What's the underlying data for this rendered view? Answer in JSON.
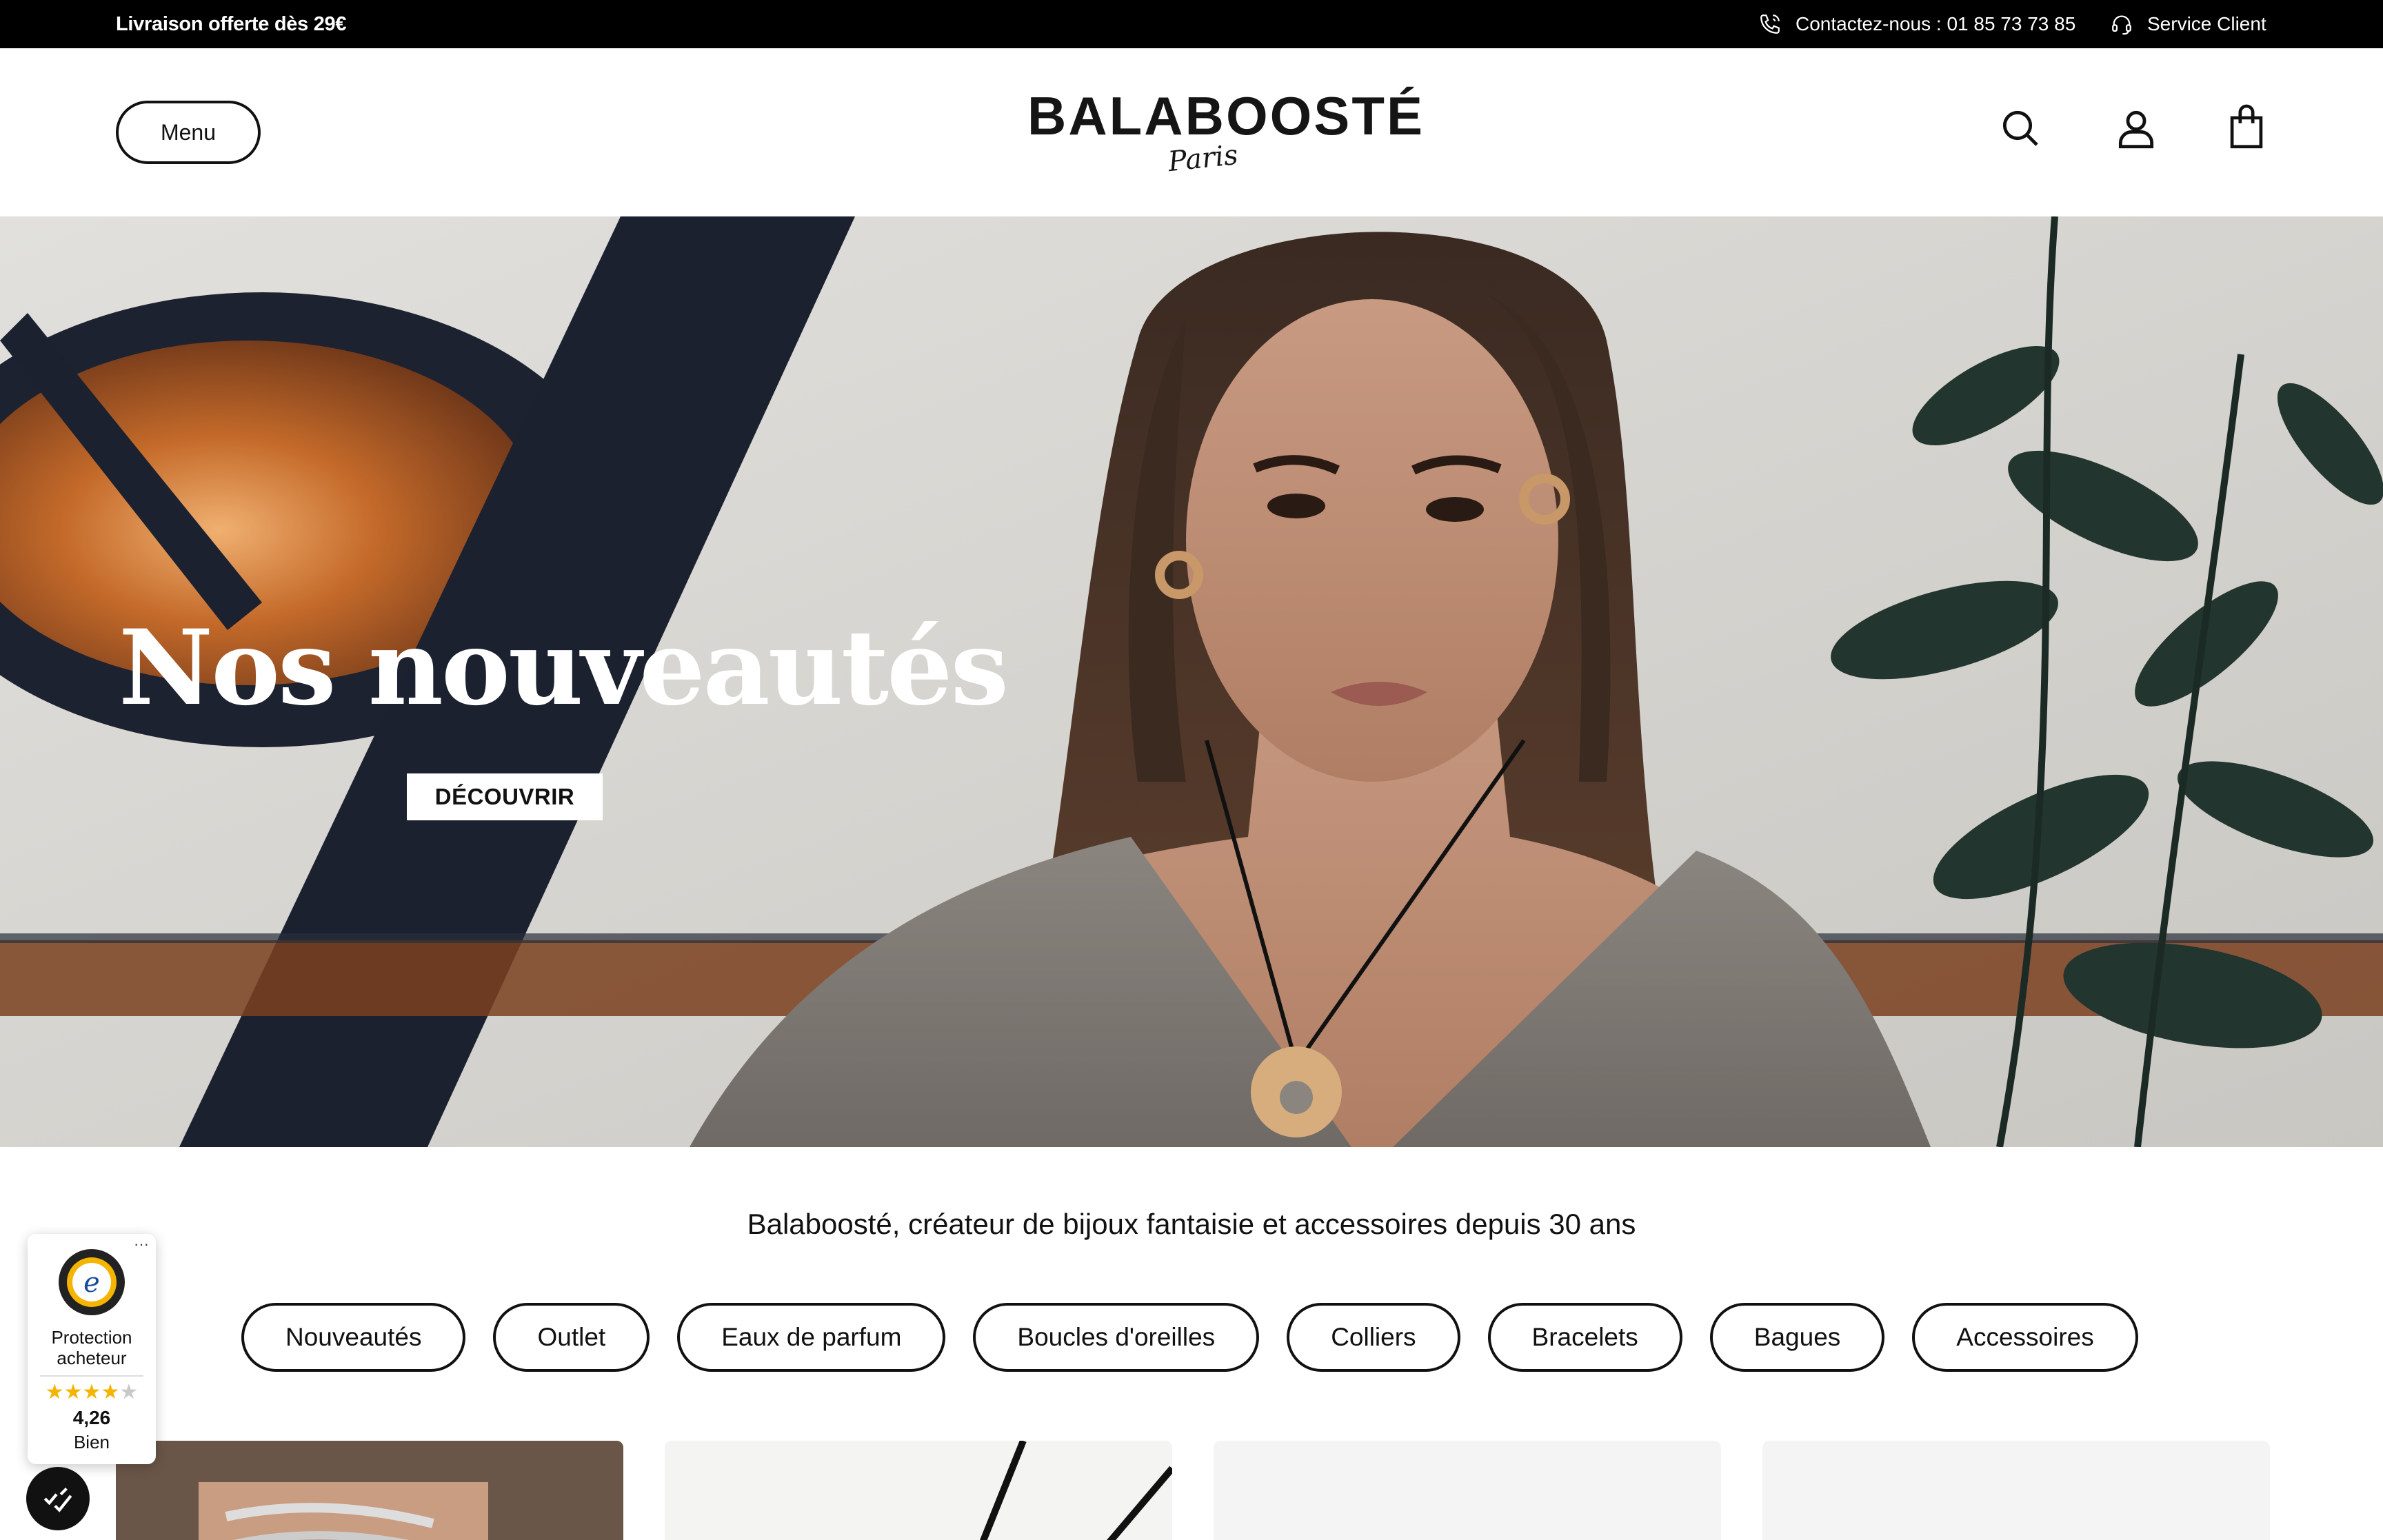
{
  "topbar": {
    "promo": "Livraison offerte dès 29€",
    "contact": "Contactez-nous : 01 85 73 73 85",
    "service": "Service Client"
  },
  "header": {
    "menu_label": "Menu",
    "logo_brand": "BALABOOSTÉ",
    "logo_city": "Paris",
    "icons": [
      "search-icon",
      "account-icon",
      "cart-icon"
    ]
  },
  "hero": {
    "title": "Nos nouveautés",
    "cta": "DÉCOUVRIR"
  },
  "tagline": "Balaboosté, créateur de bijoux fantaisie et accessoires depuis 30 ans",
  "categories": [
    "Nouveautés",
    "Outlet",
    "Eaux de parfum",
    "Boucles d'oreilles",
    "Colliers",
    "Bracelets",
    "Bagues",
    "Accessoires"
  ],
  "trust_widget": {
    "line1": "Protection",
    "line2": "acheteur",
    "rating": "4,26",
    "rating_value": 4.26,
    "rating_max": 5,
    "label": "Bien",
    "seal_letter": "e"
  },
  "colors": {
    "topbar_bg": "#000000",
    "accent_star": "#f4b400"
  }
}
